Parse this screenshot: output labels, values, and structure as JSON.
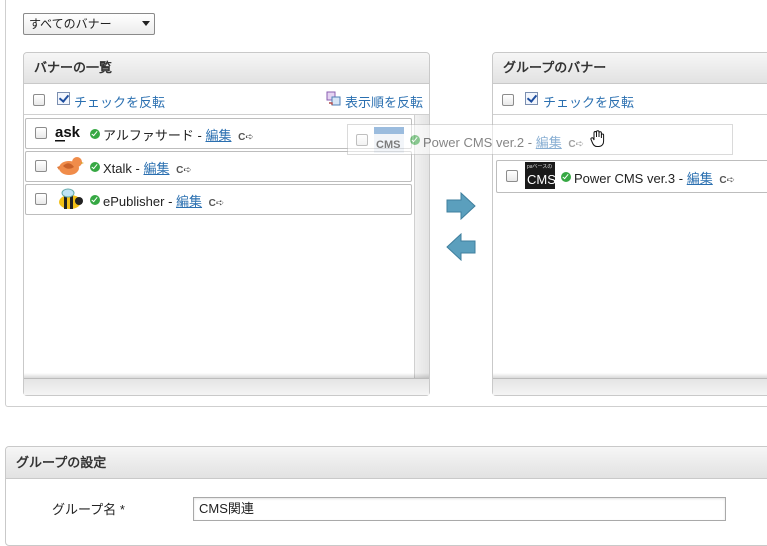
{
  "filter": {
    "selected": "すべてのバナー"
  },
  "left_panel": {
    "title": "バナーの一覧",
    "toggle_check_label": "チェックを反転",
    "reverse_order_label": "表示順を反転",
    "items": [
      {
        "name": "アルファサード",
        "separator": "-",
        "edit": "編集",
        "thumb_text": "ask"
      },
      {
        "name": "Xtalk",
        "separator": "-",
        "edit": "編集"
      },
      {
        "name": "ePublisher",
        "separator": "-",
        "edit": "編集"
      }
    ]
  },
  "drag_ghost": {
    "name": "Power CMS ver.2",
    "separator": "-",
    "edit": "編集",
    "thumb_text": "CMS"
  },
  "right_panel": {
    "title": "グループのバナー",
    "toggle_check_label": "チェックを反転",
    "items": [
      {
        "name": "Power CMS ver.3",
        "separator": "-",
        "edit": "編集",
        "thumb_text": "CMS"
      }
    ]
  },
  "settings": {
    "title": "グループの設定",
    "name_label": "グループ名",
    "required_mark": "*",
    "name_value": "CMS関連"
  },
  "colors": {
    "link": "#2a6fb0",
    "arrow": "#5b9fbd",
    "status_ok": "#36a843"
  },
  "icons": [
    "check-toggle-icon",
    "reorder-icon",
    "status-published-icon",
    "external-link-icon",
    "arrow-right-icon",
    "arrow-left-icon",
    "hand-cursor-icon"
  ]
}
